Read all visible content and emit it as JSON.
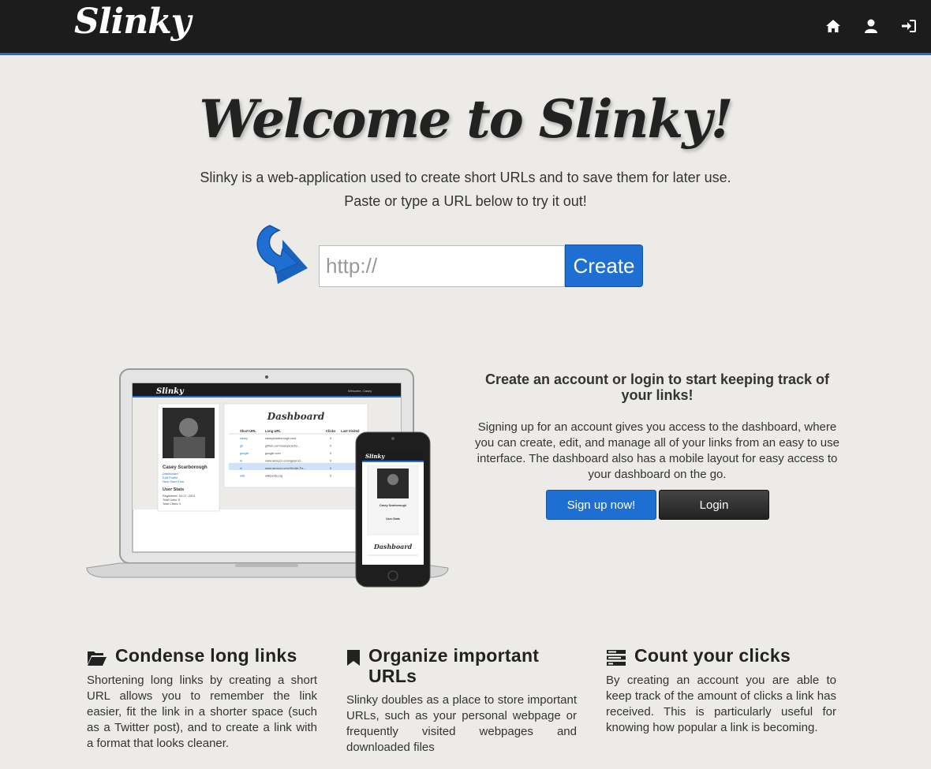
{
  "navbar": {
    "brand": "Slinky",
    "icons": [
      "home-icon",
      "user-icon",
      "sign-in-icon"
    ],
    "accent_color": "#1f6fd2"
  },
  "hero": {
    "title": "Welcome to Slinky!",
    "subtitle_1": "Slinky is a web-application used to create short URLs and to save them for later use.",
    "subtitle_2": "Paste or type a URL below to try it out!",
    "url_placeholder": "http://",
    "url_value": "",
    "create_label": "Create"
  },
  "promo": {
    "title": "Create an account or login to start keeping track of your links!",
    "text": "Signing up for an account gives you access to the dashboard, where you can create, edit, and manage all of your links from an easy to use interface. The dashboard also has a mobile layout for easy access to your dashboard on the go.",
    "signup_label": "Sign up now!",
    "login_label": "Login"
  },
  "mockup": {
    "brand": "Slinky",
    "welcome": "Welcome, Casey",
    "dashboard_title": "Dashboard",
    "user_name": "Casey Scarborough",
    "user_links": [
      "Dashboard",
      "Edit Profile",
      "New Short Link"
    ],
    "stats_title": "User Stats",
    "stats": [
      "Registered: Jul 27, 2013",
      "Total Links: 6",
      "Total Clicks: 0"
    ],
    "columns": [
      "Short URL",
      "Long URL",
      "Clicks",
      "Last Visited"
    ],
    "rows": [
      [
        "casey",
        "caseyscarborough.com",
        "0"
      ],
      [
        "gh",
        "github.com/caseyscarbo...",
        "0"
      ],
      [
        "google",
        "google.com",
        "0"
      ],
      [
        "rk",
        "www.amazon.com/gp/prod...",
        "0"
      ],
      [
        "rk",
        "www.amazon.com/Kindle-Pa...",
        "0"
      ],
      [
        "wiki",
        "wikipedia.org",
        "0"
      ]
    ]
  },
  "features": [
    {
      "icon": "folder-open-icon",
      "title": "Condense long links",
      "text": "Shortening long links by creating a short URL allows you to remember the link easier, fit the link in a shorter space (such as a Twitter post), and to create a link with a format that looks cleaner."
    },
    {
      "icon": "bookmark-icon",
      "title": "Organize important URLs",
      "text": "Slinky doubles as a place to store important URLs, such as your personal webpage or frequently visited webpages and downloaded files"
    },
    {
      "icon": "tasks-icon",
      "title": "Count your clicks",
      "text": "By creating an account you are able to keep track of the amount of clicks a link has received. This is particularly useful for knowing how popular a link is becoming."
    }
  ]
}
